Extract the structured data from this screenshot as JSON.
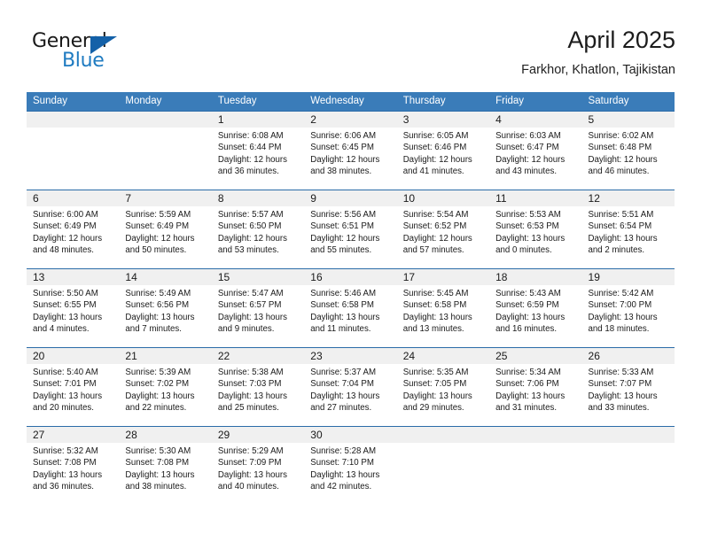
{
  "brand": {
    "name_part1": "General",
    "name_part2": "Blue",
    "triangle_color": "#1461a8",
    "blue_color": "#1f7bc1"
  },
  "header": {
    "month_title": "April 2025",
    "location": "Farkhor, Khatlon, Tajikistan",
    "header_bg": "#3a7cb9",
    "row_rule": "#2b6ca8",
    "daynum_bg": "#f0f0f0"
  },
  "weekdays": [
    "Sunday",
    "Monday",
    "Tuesday",
    "Wednesday",
    "Thursday",
    "Friday",
    "Saturday"
  ],
  "weeks": [
    [
      {
        "day": "",
        "sunrise": "",
        "sunset": "",
        "daylight1": "",
        "daylight2": ""
      },
      {
        "day": "",
        "sunrise": "",
        "sunset": "",
        "daylight1": "",
        "daylight2": ""
      },
      {
        "day": "1",
        "sunrise": "Sunrise: 6:08 AM",
        "sunset": "Sunset: 6:44 PM",
        "daylight1": "Daylight: 12 hours",
        "daylight2": "and 36 minutes."
      },
      {
        "day": "2",
        "sunrise": "Sunrise: 6:06 AM",
        "sunset": "Sunset: 6:45 PM",
        "daylight1": "Daylight: 12 hours",
        "daylight2": "and 38 minutes."
      },
      {
        "day": "3",
        "sunrise": "Sunrise: 6:05 AM",
        "sunset": "Sunset: 6:46 PM",
        "daylight1": "Daylight: 12 hours",
        "daylight2": "and 41 minutes."
      },
      {
        "day": "4",
        "sunrise": "Sunrise: 6:03 AM",
        "sunset": "Sunset: 6:47 PM",
        "daylight1": "Daylight: 12 hours",
        "daylight2": "and 43 minutes."
      },
      {
        "day": "5",
        "sunrise": "Sunrise: 6:02 AM",
        "sunset": "Sunset: 6:48 PM",
        "daylight1": "Daylight: 12 hours",
        "daylight2": "and 46 minutes."
      }
    ],
    [
      {
        "day": "6",
        "sunrise": "Sunrise: 6:00 AM",
        "sunset": "Sunset: 6:49 PM",
        "daylight1": "Daylight: 12 hours",
        "daylight2": "and 48 minutes."
      },
      {
        "day": "7",
        "sunrise": "Sunrise: 5:59 AM",
        "sunset": "Sunset: 6:49 PM",
        "daylight1": "Daylight: 12 hours",
        "daylight2": "and 50 minutes."
      },
      {
        "day": "8",
        "sunrise": "Sunrise: 5:57 AM",
        "sunset": "Sunset: 6:50 PM",
        "daylight1": "Daylight: 12 hours",
        "daylight2": "and 53 minutes."
      },
      {
        "day": "9",
        "sunrise": "Sunrise: 5:56 AM",
        "sunset": "Sunset: 6:51 PM",
        "daylight1": "Daylight: 12 hours",
        "daylight2": "and 55 minutes."
      },
      {
        "day": "10",
        "sunrise": "Sunrise: 5:54 AM",
        "sunset": "Sunset: 6:52 PM",
        "daylight1": "Daylight: 12 hours",
        "daylight2": "and 57 minutes."
      },
      {
        "day": "11",
        "sunrise": "Sunrise: 5:53 AM",
        "sunset": "Sunset: 6:53 PM",
        "daylight1": "Daylight: 13 hours",
        "daylight2": "and 0 minutes."
      },
      {
        "day": "12",
        "sunrise": "Sunrise: 5:51 AM",
        "sunset": "Sunset: 6:54 PM",
        "daylight1": "Daylight: 13 hours",
        "daylight2": "and 2 minutes."
      }
    ],
    [
      {
        "day": "13",
        "sunrise": "Sunrise: 5:50 AM",
        "sunset": "Sunset: 6:55 PM",
        "daylight1": "Daylight: 13 hours",
        "daylight2": "and 4 minutes."
      },
      {
        "day": "14",
        "sunrise": "Sunrise: 5:49 AM",
        "sunset": "Sunset: 6:56 PM",
        "daylight1": "Daylight: 13 hours",
        "daylight2": "and 7 minutes."
      },
      {
        "day": "15",
        "sunrise": "Sunrise: 5:47 AM",
        "sunset": "Sunset: 6:57 PM",
        "daylight1": "Daylight: 13 hours",
        "daylight2": "and 9 minutes."
      },
      {
        "day": "16",
        "sunrise": "Sunrise: 5:46 AM",
        "sunset": "Sunset: 6:58 PM",
        "daylight1": "Daylight: 13 hours",
        "daylight2": "and 11 minutes."
      },
      {
        "day": "17",
        "sunrise": "Sunrise: 5:45 AM",
        "sunset": "Sunset: 6:58 PM",
        "daylight1": "Daylight: 13 hours",
        "daylight2": "and 13 minutes."
      },
      {
        "day": "18",
        "sunrise": "Sunrise: 5:43 AM",
        "sunset": "Sunset: 6:59 PM",
        "daylight1": "Daylight: 13 hours",
        "daylight2": "and 16 minutes."
      },
      {
        "day": "19",
        "sunrise": "Sunrise: 5:42 AM",
        "sunset": "Sunset: 7:00 PM",
        "daylight1": "Daylight: 13 hours",
        "daylight2": "and 18 minutes."
      }
    ],
    [
      {
        "day": "20",
        "sunrise": "Sunrise: 5:40 AM",
        "sunset": "Sunset: 7:01 PM",
        "daylight1": "Daylight: 13 hours",
        "daylight2": "and 20 minutes."
      },
      {
        "day": "21",
        "sunrise": "Sunrise: 5:39 AM",
        "sunset": "Sunset: 7:02 PM",
        "daylight1": "Daylight: 13 hours",
        "daylight2": "and 22 minutes."
      },
      {
        "day": "22",
        "sunrise": "Sunrise: 5:38 AM",
        "sunset": "Sunset: 7:03 PM",
        "daylight1": "Daylight: 13 hours",
        "daylight2": "and 25 minutes."
      },
      {
        "day": "23",
        "sunrise": "Sunrise: 5:37 AM",
        "sunset": "Sunset: 7:04 PM",
        "daylight1": "Daylight: 13 hours",
        "daylight2": "and 27 minutes."
      },
      {
        "day": "24",
        "sunrise": "Sunrise: 5:35 AM",
        "sunset": "Sunset: 7:05 PM",
        "daylight1": "Daylight: 13 hours",
        "daylight2": "and 29 minutes."
      },
      {
        "day": "25",
        "sunrise": "Sunrise: 5:34 AM",
        "sunset": "Sunset: 7:06 PM",
        "daylight1": "Daylight: 13 hours",
        "daylight2": "and 31 minutes."
      },
      {
        "day": "26",
        "sunrise": "Sunrise: 5:33 AM",
        "sunset": "Sunset: 7:07 PM",
        "daylight1": "Daylight: 13 hours",
        "daylight2": "and 33 minutes."
      }
    ],
    [
      {
        "day": "27",
        "sunrise": "Sunrise: 5:32 AM",
        "sunset": "Sunset: 7:08 PM",
        "daylight1": "Daylight: 13 hours",
        "daylight2": "and 36 minutes."
      },
      {
        "day": "28",
        "sunrise": "Sunrise: 5:30 AM",
        "sunset": "Sunset: 7:08 PM",
        "daylight1": "Daylight: 13 hours",
        "daylight2": "and 38 minutes."
      },
      {
        "day": "29",
        "sunrise": "Sunrise: 5:29 AM",
        "sunset": "Sunset: 7:09 PM",
        "daylight1": "Daylight: 13 hours",
        "daylight2": "and 40 minutes."
      },
      {
        "day": "30",
        "sunrise": "Sunrise: 5:28 AM",
        "sunset": "Sunset: 7:10 PM",
        "daylight1": "Daylight: 13 hours",
        "daylight2": "and 42 minutes."
      },
      {
        "day": "",
        "sunrise": "",
        "sunset": "",
        "daylight1": "",
        "daylight2": ""
      },
      {
        "day": "",
        "sunrise": "",
        "sunset": "",
        "daylight1": "",
        "daylight2": ""
      },
      {
        "day": "",
        "sunrise": "",
        "sunset": "",
        "daylight1": "",
        "daylight2": ""
      }
    ]
  ]
}
